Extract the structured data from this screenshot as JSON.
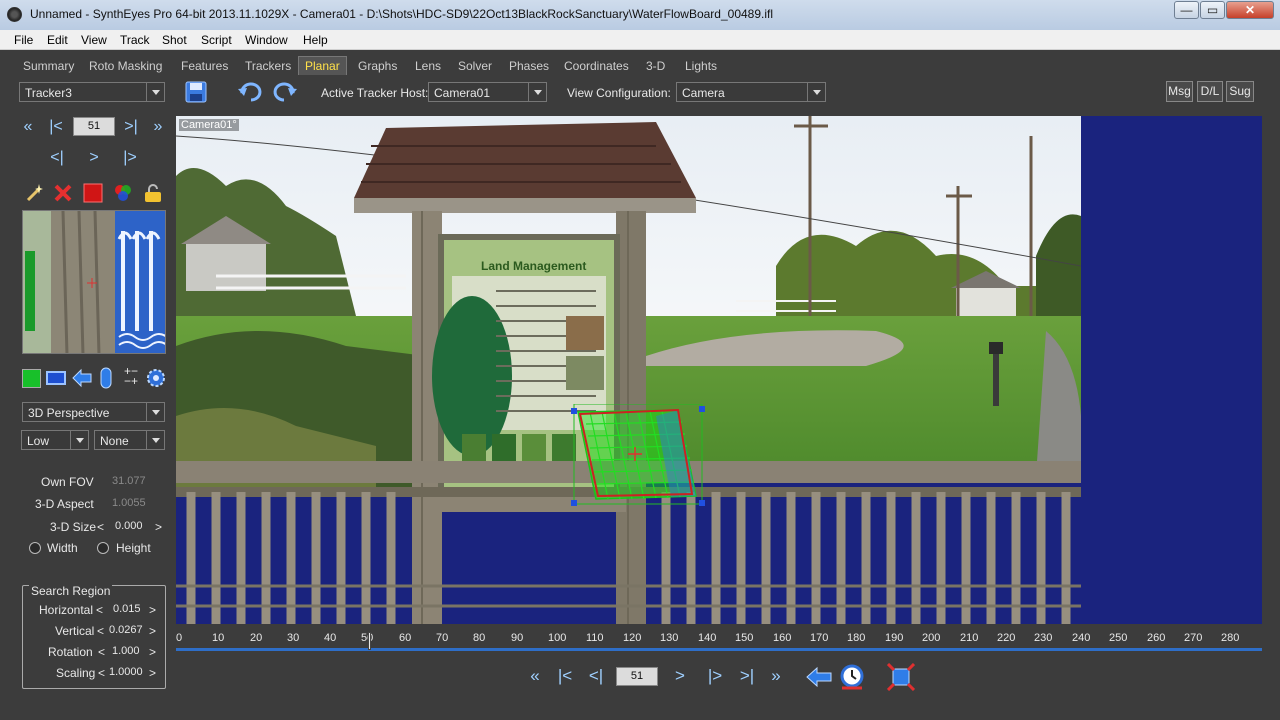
{
  "window": {
    "title": "Unnamed - SynthEyes Pro 64-bit 2013.11.1029X - Camera01 - D:\\Shots\\HDC-SD9\\22Oct13BlackRockSanctuary\\WaterFlowBoard_00489.ifl",
    "min_glyph": "—",
    "max_glyph": "▭",
    "close_glyph": "✕"
  },
  "menu": [
    "File",
    "Edit",
    "View",
    "Track",
    "Shot",
    "Script",
    "Window",
    "Help"
  ],
  "tabs": [
    "Summary",
    "Roto Masking",
    "Features",
    "Trackers",
    "Planar",
    "Graphs",
    "Lens",
    "Solver",
    "Phases",
    "Coordinates",
    "3-D",
    "Lights"
  ],
  "active_tab": "Planar",
  "toolbar": {
    "tracker_select": "Tracker3",
    "active_tracker_host_label": "Active Tracker Host:",
    "active_tracker_host_value": "Camera01",
    "view_configuration_label": "View Configuration:",
    "view_configuration_value": "Camera",
    "msg_label": "Msg",
    "dl_label": "D/L",
    "sug_label": "Sug"
  },
  "left_panel": {
    "frame_number": "51",
    "nav_glyphs": {
      "first": "«",
      "prev_key": "|<",
      "next_key": ">|",
      "last": "»",
      "prev_frame": "<|",
      "play": ">",
      "next_frame": "|>"
    },
    "planar_icon_glyphs": {
      "plus_minus": "+−",
      "plus_minus_2": "−+"
    },
    "mode_select": "3D Perspective",
    "quality_select": "Low",
    "secondary_select": "None",
    "own_fov_label": "Own FOV",
    "own_fov_value": "31.077",
    "aspect_label": "3-D Aspect",
    "aspect_value": "1.0055",
    "size_label": "3-D Size",
    "size_value": "0.000",
    "width_label": "Width",
    "height_label": "Height",
    "search_region_title": "Search Region",
    "horizontal_label": "Horizontal",
    "horizontal_value": "0.015",
    "vertical_label": "Vertical",
    "vertical_value": "0.0267",
    "rotation_label": "Rotation",
    "rotation_value": "1.000",
    "scaling_label": "Scaling",
    "scaling_value": "1.0000",
    "lt": "<",
    "gt": ">"
  },
  "viewport": {
    "camera_label": "Camera01°",
    "sign_title": "Land Management"
  },
  "timeline": {
    "ticks": [
      "0",
      "10",
      "20",
      "30",
      "40",
      "50",
      "60",
      "70",
      "80",
      "90",
      "100",
      "110",
      "120",
      "130",
      "140",
      "150",
      "160",
      "170",
      "180",
      "190",
      "200",
      "210",
      "220",
      "230",
      "240",
      "250",
      "260",
      "270",
      "280"
    ],
    "current_frame": 51
  },
  "transport": {
    "frame_number": "51",
    "glyphs": {
      "first": "«",
      "prev_key": "|<",
      "prev_frame": "<|",
      "next": ">",
      "next_frame": "|>",
      "next_key": ">|",
      "last": "»"
    }
  },
  "colors": {
    "accent_tab": "#ffe14a",
    "panel_bg": "#3c3c3c",
    "viewport_bg": "#1a237e",
    "timeline_bar": "#2e6ec8",
    "tracker_green": "#22dd22",
    "tracker_red": "#cc2222"
  }
}
